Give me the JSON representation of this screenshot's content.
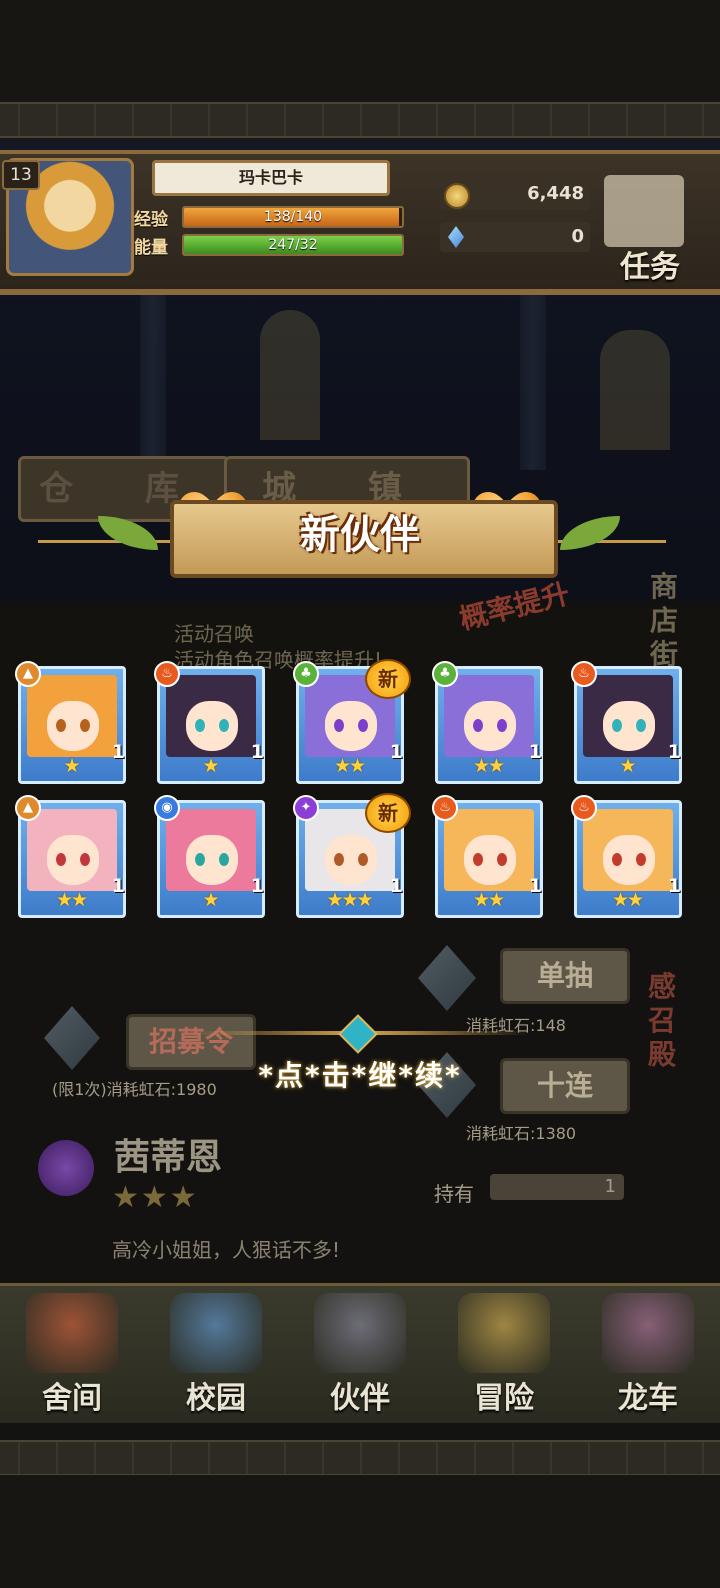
{
  "player": {
    "level": "13",
    "name": "玛卡巴卡"
  },
  "stats": {
    "exp_label": "经验",
    "exp_value": "138/140",
    "exp_fraction": 0.986,
    "energy_label": "能量",
    "energy_value": "247/32",
    "energy_fraction": 1.0
  },
  "resources": {
    "gold": "6,448",
    "gems": "0"
  },
  "task_label": "任务",
  "tabs": {
    "warehouse": "仓 库",
    "town": "城 镇"
  },
  "banner_title": "新伙伴",
  "bg_texts": {
    "event_summon": "活动召唤",
    "event_rate": "活动角色召唤概率提升!",
    "promo": "概率提升",
    "shop": "商店街",
    "temple": "感召殿"
  },
  "new_badge": "新",
  "cards": [
    {
      "element": "earth",
      "stars": 1,
      "count": "1",
      "hair": "#f2a13d",
      "eye": "#b5621d",
      "is_new": false
    },
    {
      "element": "fire",
      "stars": 1,
      "count": "1",
      "hair": "#3b2a45",
      "eye": "#2fb3b8",
      "is_new": false
    },
    {
      "element": "wood",
      "stars": 2,
      "count": "1",
      "hair": "#8a6fd8",
      "eye": "#7d3fc9",
      "is_new": true
    },
    {
      "element": "wood",
      "stars": 2,
      "count": "1",
      "hair": "#8a6fd8",
      "eye": "#7d3fc9",
      "is_new": false
    },
    {
      "element": "fire",
      "stars": 1,
      "count": "1",
      "hair": "#3b2a45",
      "eye": "#2fb3b8",
      "is_new": false
    },
    {
      "element": "earth",
      "stars": 2,
      "count": "1",
      "hair": "#f2b3be",
      "eye": "#c2373b",
      "is_new": false
    },
    {
      "element": "water",
      "stars": 1,
      "count": "1",
      "hair": "#ec7a9c",
      "eye": "#2aa6a0",
      "is_new": false
    },
    {
      "element": "dark",
      "stars": 3,
      "count": "1",
      "hair": "#e9e6ea",
      "eye": "#b05a2a",
      "is_new": true
    },
    {
      "element": "fire",
      "stars": 2,
      "count": "1",
      "hair": "#f6b65a",
      "eye": "#c33b2b",
      "is_new": false
    },
    {
      "element": "fire",
      "stars": 2,
      "count": "1",
      "hair": "#f6b65a",
      "eye": "#c33b2b",
      "is_new": false
    }
  ],
  "element_colors": {
    "earth": "#e08a2e",
    "fire": "#e85a1e",
    "wood": "#5bb23a",
    "water": "#3a7be0",
    "dark": "#8c3fd6"
  },
  "summon": {
    "single_label": "单抽",
    "single_cost": "消耗虹石:148",
    "ten_label": "十连",
    "ten_cost": "消耗虹石:1380",
    "recruit_label": "招募令",
    "recruit_cost": "(限1次)消耗虹石:1980",
    "hold_label": "持有",
    "hold_value": "1"
  },
  "featured": {
    "name": "茜蒂恩",
    "stars": "★★★",
    "quote": "高冷小姐姐，人狠话不多!"
  },
  "continue_text": "*点*击*继*续*",
  "nav": [
    {
      "label": "舍间",
      "icon": "house-icon"
    },
    {
      "label": "校园",
      "icon": "campus-icon"
    },
    {
      "label": "伙伴",
      "icon": "partner-icon"
    },
    {
      "label": "冒险",
      "icon": "adventure-icon"
    },
    {
      "label": "龙车",
      "icon": "dragon-cart-icon"
    }
  ]
}
